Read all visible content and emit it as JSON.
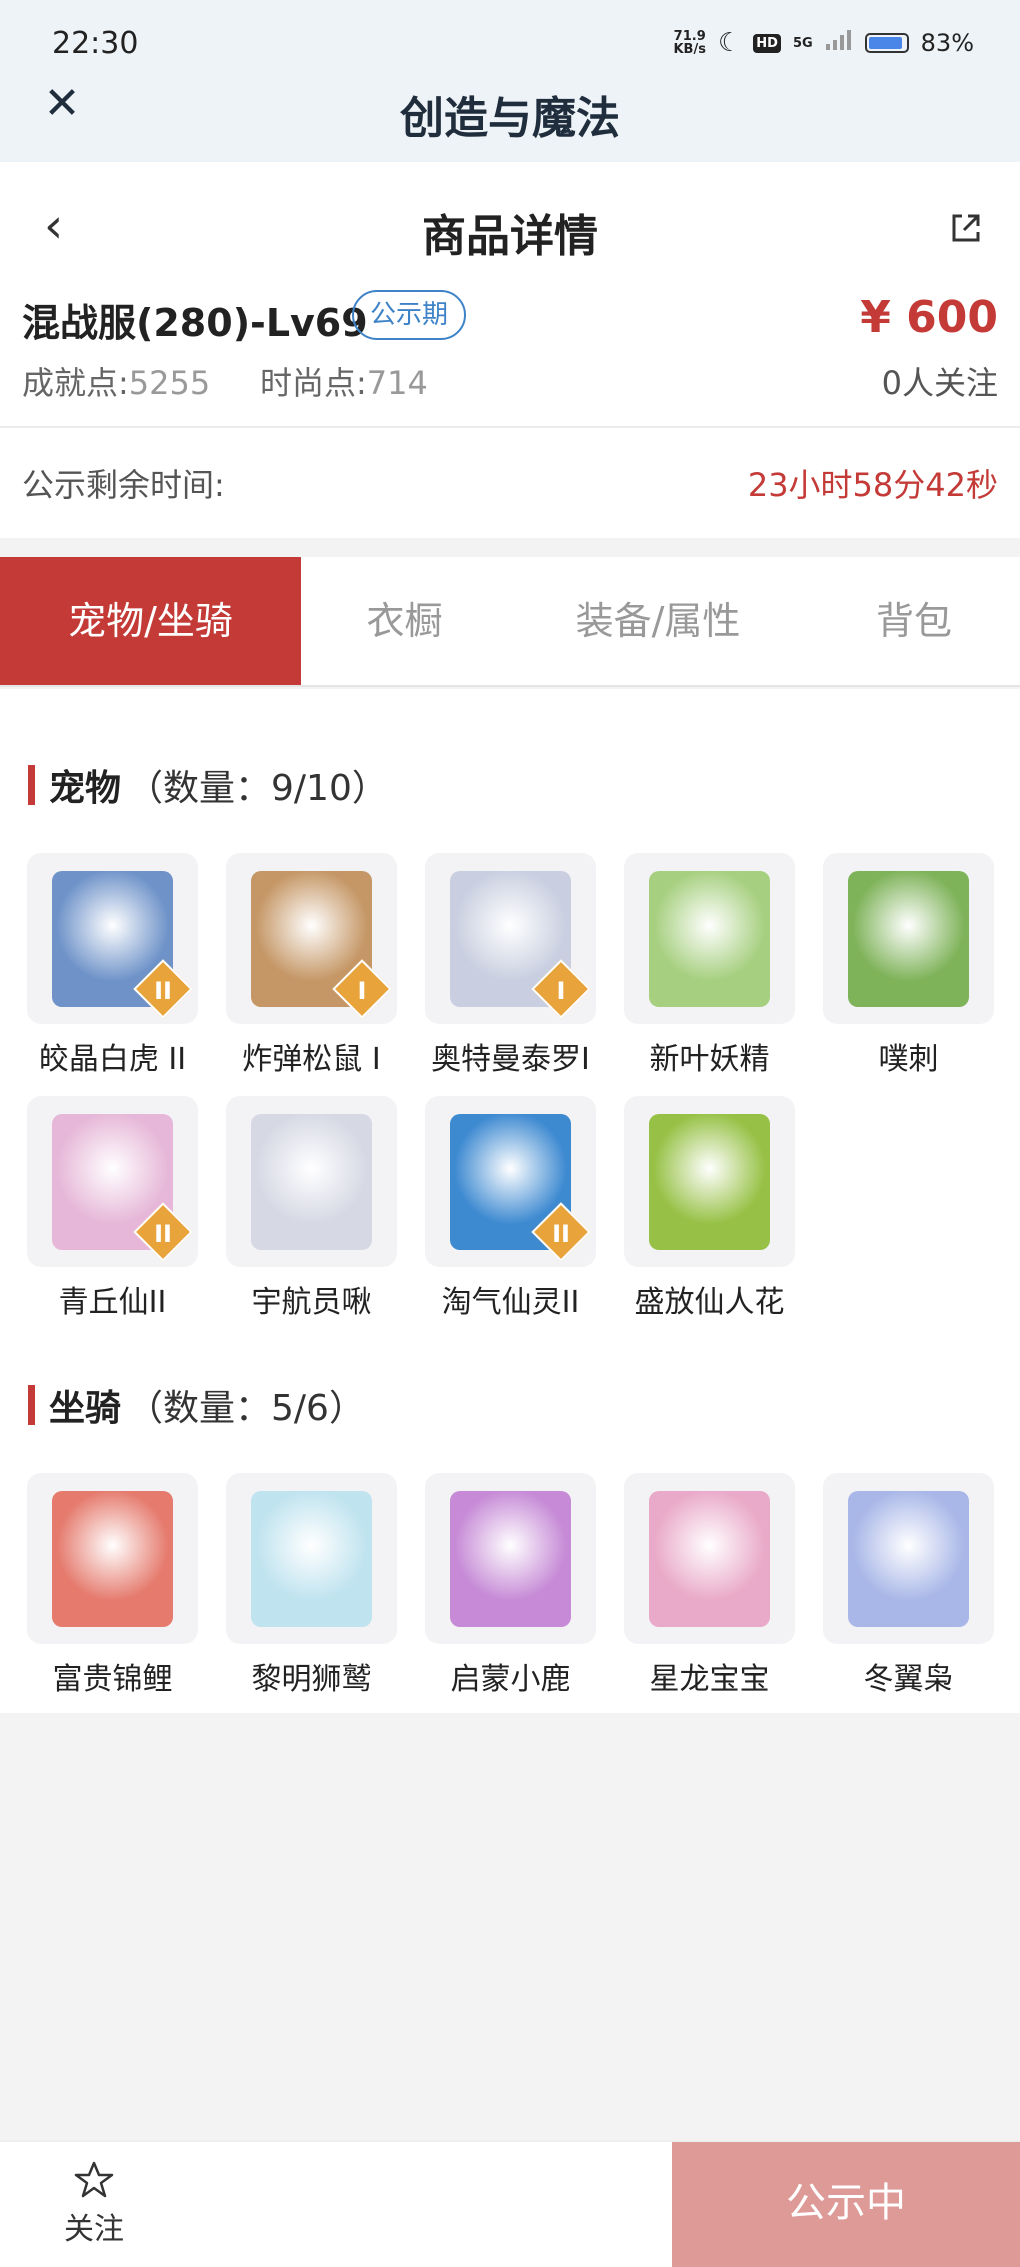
{
  "status_bar": {
    "time": "22:30",
    "net_speed_value": "71.9",
    "net_speed_unit": "KB/s",
    "hd": "HD",
    "network": "5G",
    "battery": "83%",
    "battery_level": 0.83
  },
  "app_header": {
    "close_icon": "close-icon",
    "title": "创造与魔法"
  },
  "detail": {
    "title": "商品详情",
    "server": "混战服(280)-Lv69",
    "badge": "公示期",
    "price": "¥ 600",
    "achievement_label": "成就点:",
    "achievement_value": "5255",
    "fashion_label": "时尚点:",
    "fashion_value": "714",
    "followers": "0人关注",
    "remaining_label": "公示剩余时间:",
    "remaining_value": "23小时58分42秒"
  },
  "tabs": [
    {
      "label": "宠物/坐骑",
      "active": true
    },
    {
      "label": "衣橱",
      "active": false
    },
    {
      "label": "装备/属性",
      "active": false
    },
    {
      "label": "背包",
      "active": false
    }
  ],
  "pets": {
    "title": "宠物",
    "count": "（数量：9/10）",
    "items": [
      {
        "name": "皎晶白虎 II",
        "tier": "II",
        "color": "#6f93c9"
      },
      {
        "name": "炸弹松鼠 I",
        "tier": "I",
        "color": "#c59766"
      },
      {
        "name": "奥特曼泰罗I",
        "tier": "I",
        "color": "#c9cfe0"
      },
      {
        "name": "新叶妖精",
        "tier": "",
        "color": "#a6cf7f"
      },
      {
        "name": "噗刺",
        "tier": "",
        "color": "#7fb35a"
      },
      {
        "name": "青丘仙II",
        "tier": "II",
        "color": "#e6b7d8"
      },
      {
        "name": "宇航员啾",
        "tier": "",
        "color": "#d6d8e4"
      },
      {
        "name": "淘气仙灵II",
        "tier": "II",
        "color": "#3e8ad1"
      },
      {
        "name": "盛放仙人花",
        "tier": "",
        "color": "#97c146"
      }
    ]
  },
  "mounts": {
    "title": "坐骑",
    "count": "（数量：5/6）",
    "items": [
      {
        "name": "富贵锦鲤",
        "color": "#e57a6d"
      },
      {
        "name": "黎明狮鹫",
        "color": "#bfe3ef"
      },
      {
        "name": "启蒙小鹿",
        "color": "#c68ad6"
      },
      {
        "name": "星龙宝宝",
        "color": "#e9a9c8"
      },
      {
        "name": "冬翼枭",
        "color": "#a9b7e8"
      }
    ]
  },
  "bottom": {
    "follow": "关注",
    "status": "公示中"
  }
}
